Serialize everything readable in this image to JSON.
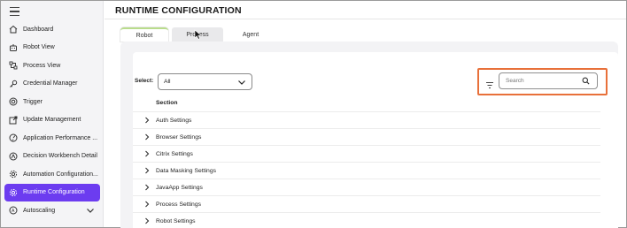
{
  "app": {
    "page_title": "RUNTIME CONFIGURATION"
  },
  "sidebar": {
    "menu_icon": "hamburger-icon",
    "items": [
      {
        "label": "Dashboard",
        "icon": "home-icon"
      },
      {
        "label": "Robot View",
        "icon": "robot-icon"
      },
      {
        "label": "Process View",
        "icon": "process-icon"
      },
      {
        "label": "Credential Manager",
        "icon": "key-icon"
      },
      {
        "label": "Trigger",
        "icon": "trigger-icon"
      },
      {
        "label": "Update Management",
        "icon": "update-icon"
      },
      {
        "label": "Application Performance ...",
        "icon": "gauge-icon"
      },
      {
        "label": "Decision Workbench Detail",
        "icon": "decision-icon"
      },
      {
        "label": "Automation Configuration...",
        "icon": "gear-icon"
      },
      {
        "label": "Runtime Configuration",
        "icon": "runtime-gear-icon",
        "active": true
      },
      {
        "label": "Autoscaling",
        "icon": "autoscaling-icon",
        "expandable": true
      }
    ],
    "active_color": "#6c3cf0"
  },
  "tabs": [
    {
      "label": "Robot",
      "active": true
    },
    {
      "label": "Process"
    },
    {
      "label": "Agent"
    }
  ],
  "filters": {
    "select_label": "Select:",
    "select_value": "All",
    "search_placeholder": "Search",
    "highlight_color": "#e8703a"
  },
  "table": {
    "header": "Section",
    "rows": [
      "Auth Settings",
      "Browser Settings",
      "Citrix Settings",
      "Data Masking Settings",
      "JavaApp Settings",
      "Process Settings",
      "Robot Settings"
    ]
  }
}
